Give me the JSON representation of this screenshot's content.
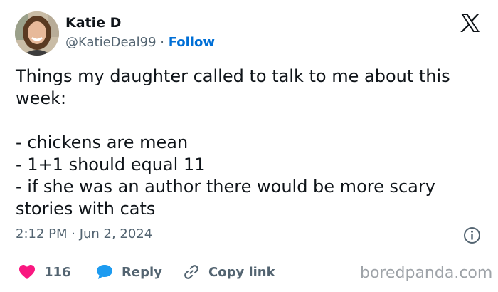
{
  "author": {
    "name": "Katie D",
    "handle": "@KatieDeal99",
    "separator": " · ",
    "follow_label": "Follow",
    "avatar_icon": "profile-photo"
  },
  "brand": {
    "logo_icon": "x-logo",
    "accent_color": "#006fd6",
    "like_color": "#f91880",
    "reply_color": "#1d9bf0"
  },
  "tweet": {
    "text": "Things my daughter called to talk to me about this week:\n\n- chickens are mean\n- 1+1 should equal 11\n- if she was an author there would be more scary stories with cats",
    "timestamp": "2:12 PM · Jun 2, 2024"
  },
  "actions": {
    "like_count": "116",
    "reply_label": "Reply",
    "copy_label": "Copy link",
    "info_icon": "info-icon"
  },
  "watermark": "boredpanda.com"
}
